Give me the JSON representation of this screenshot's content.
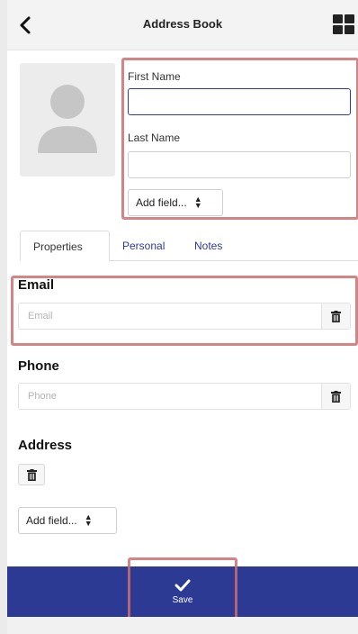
{
  "header": {
    "title": "Address Book",
    "back_icon": "chevron-left-icon",
    "menu_icon": "grid-icon"
  },
  "avatar": {
    "icon": "person-icon"
  },
  "name_form": {
    "first_name_label": "First Name",
    "first_name_value": "",
    "last_name_label": "Last Name",
    "last_name_value": "",
    "add_field_label": "Add field..."
  },
  "tabs": [
    {
      "label": "Properties",
      "active": true
    },
    {
      "label": "Personal",
      "active": false
    },
    {
      "label": "Notes",
      "active": false
    }
  ],
  "email": {
    "heading": "Email",
    "placeholder": "Email",
    "value": ""
  },
  "phone": {
    "heading": "Phone",
    "placeholder": "Phone",
    "value": ""
  },
  "address": {
    "heading": "Address",
    "add_field_label": "Add field..."
  },
  "footer": {
    "save_label": "Save",
    "save_icon": "checkmark-icon"
  },
  "colors": {
    "accent": "#2d3a94",
    "link": "#2c3a9a",
    "highlight": "#cd6e6e",
    "header_bg": "#f3f3f3"
  }
}
